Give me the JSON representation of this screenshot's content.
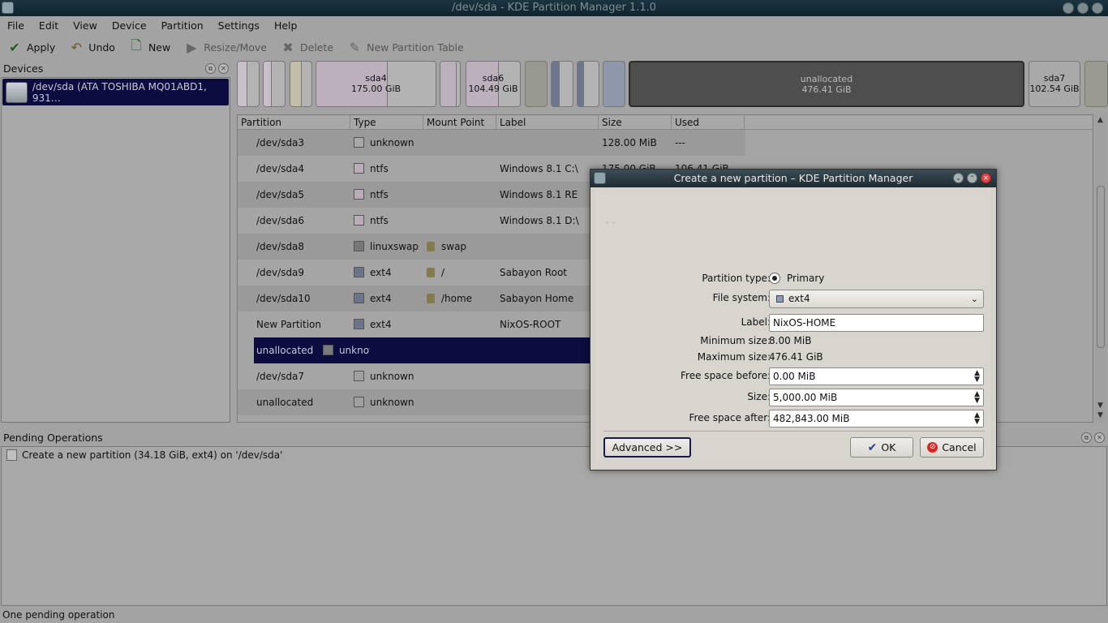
{
  "window": {
    "title": "/dev/sda - KDE Partition Manager 1.1.0"
  },
  "menu": [
    "File",
    "Edit",
    "View",
    "Device",
    "Partition",
    "Settings",
    "Help"
  ],
  "toolbar": {
    "apply": "Apply",
    "undo": "Undo",
    "new": "New",
    "resize_move": "Resize/Move",
    "delete": "Delete",
    "new_partition_table": "New Partition Table"
  },
  "devices": {
    "title": "Devices",
    "items": [
      {
        "label": "/dev/sda (ATA TOSHIBA MQ01ABD1, 931…"
      }
    ]
  },
  "partition_map": {
    "segments": [
      {
        "name": "sda4",
        "size": "175.00 GiB"
      },
      {
        "name": "sda6",
        "size": "104.49 GiB"
      },
      {
        "name": "unallocated",
        "size": "476.41 GiB"
      },
      {
        "name": "sda7",
        "size": "102.54 GiB"
      }
    ]
  },
  "partition_table": {
    "columns": [
      "Partition",
      "Type",
      "Mount Point",
      "Label",
      "Size",
      "Used"
    ],
    "rows": [
      {
        "partition": "/dev/sda3",
        "type": "unknown",
        "mount": "",
        "label": "",
        "size": "128.00 MiB",
        "used": "---",
        "color": "#a8a8a8"
      },
      {
        "partition": "/dev/sda4",
        "type": "ntfs",
        "mount": "",
        "label": "Windows 8.1 C:\\",
        "size": "175.00 GiB",
        "used": "106.41 GiB",
        "color": "#b9adb9"
      },
      {
        "partition": "/dev/sda5",
        "type": "ntfs",
        "mount": "",
        "label": "Windows 8.1 RE",
        "size": "",
        "used": "",
        "color": "#b9adb9"
      },
      {
        "partition": "/dev/sda6",
        "type": "ntfs",
        "mount": "",
        "label": "Windows 8.1 D:\\",
        "size": "",
        "used": "",
        "color": "#b9adb9"
      },
      {
        "partition": "/dev/sda8",
        "type": "linuxswap",
        "mount": "swap",
        "label": "",
        "size": "",
        "used": "",
        "color": "#777777"
      },
      {
        "partition": "/dev/sda9",
        "type": "ext4",
        "mount": "/",
        "label": "Sabayon Root",
        "size": "",
        "used": "",
        "color": "#6b7488"
      },
      {
        "partition": "/dev/sda10",
        "type": "ext4",
        "mount": "/home",
        "label": "Sabayon Home",
        "size": "",
        "used": "",
        "color": "#6b7488"
      },
      {
        "partition": "New Partition",
        "type": "ext4",
        "mount": "",
        "label": "NixOS-ROOT",
        "size": "",
        "used": "",
        "color": "#6b7488"
      },
      {
        "partition": "unallocated",
        "type": "unknown",
        "mount": "",
        "label": "",
        "size": "",
        "used": "",
        "color": "#7a7a7a"
      },
      {
        "partition": "/dev/sda7",
        "type": "unknown",
        "mount": "",
        "label": "",
        "size": "",
        "used": "",
        "color": "#a0a0a0"
      },
      {
        "partition": "unallocated",
        "type": "unknown",
        "mount": "",
        "label": "",
        "size": "",
        "used": "",
        "color": "#a0a0a0"
      }
    ]
  },
  "pending": {
    "title": "Pending Operations",
    "items": [
      "Create a new partition (34.18 GiB, ext4) on '/dev/sda'"
    ]
  },
  "status": "One pending operation",
  "dialog": {
    "title": "Create a new partition – KDE Partition Manager",
    "partition_type_label": "Partition type:",
    "partition_type_value": "Primary",
    "file_system_label": "File system:",
    "file_system_value": "ext4",
    "label_label": "Label:",
    "label_value": "NixOS-HOME",
    "min_size_label": "Minimum size:",
    "min_size_value": "8.00 MiB",
    "max_size_label": "Maximum size:",
    "max_size_value": "476.41 GiB",
    "free_before_label": "Free space before:",
    "free_before_value": "0.00 MiB",
    "size_label": "Size:",
    "size_value": "5,000.00 MiB",
    "free_after_label": "Free space after:",
    "free_after_value": "482,843.00 MiB",
    "advanced": "Advanced >>",
    "ok": "OK",
    "cancel": "Cancel"
  }
}
